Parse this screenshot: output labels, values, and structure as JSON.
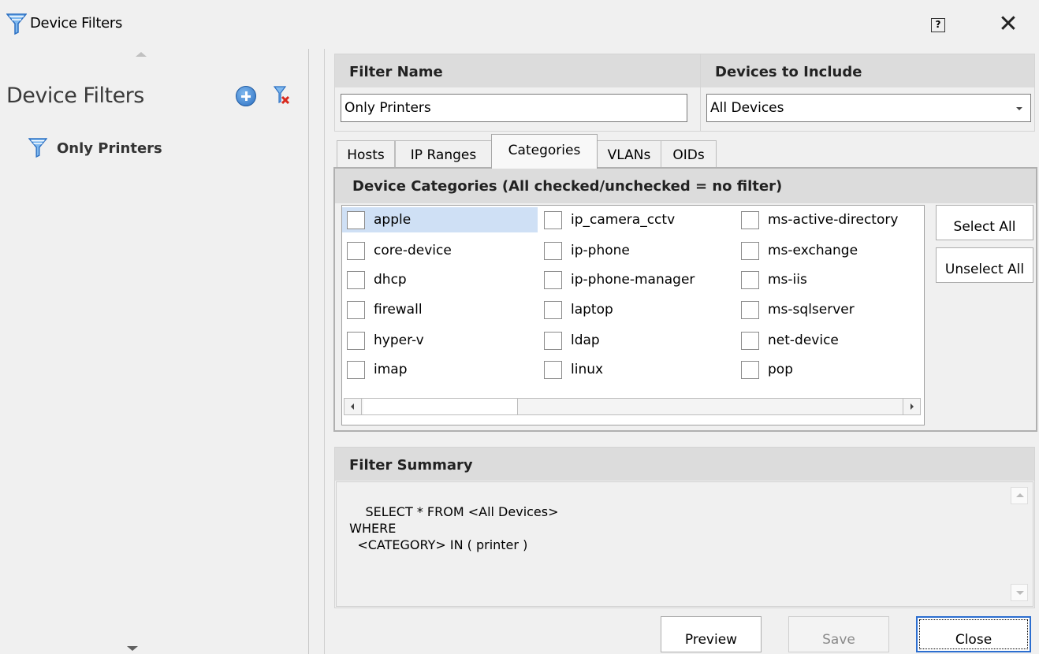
{
  "window": {
    "title": "Device Filters",
    "help_label": "?",
    "close_label": "✕"
  },
  "sidebar": {
    "title": "Device Filters",
    "items": [
      {
        "label": "Only Printers"
      }
    ]
  },
  "filter_name": {
    "header": "Filter Name",
    "value": "Only Printers"
  },
  "devices_to_include": {
    "header": "Devices to Include",
    "selected": "All Devices"
  },
  "tabs": [
    {
      "label": "Hosts"
    },
    {
      "label": "IP Ranges"
    },
    {
      "label": "Categories",
      "active": true
    },
    {
      "label": "VLANs"
    },
    {
      "label": "OIDs"
    }
  ],
  "categories": {
    "header": "Device Categories (All checked/unchecked = no filter)",
    "columns": [
      [
        "apple",
        "core-device",
        "dhcp",
        "firewall",
        "hyper-v",
        "imap"
      ],
      [
        "ip_camera_cctv",
        "ip-phone",
        "ip-phone-manager",
        "laptop",
        "ldap",
        "linux"
      ],
      [
        "ms-active-directory",
        "ms-exchange",
        "ms-iis",
        "ms-sqlserver",
        "net-device",
        "pop"
      ]
    ],
    "selected_item": "apple",
    "select_all_label": "Select All",
    "unselect_all_label": "Unselect All"
  },
  "summary": {
    "header": "Filter Summary",
    "text": "SELECT * FROM <All Devices>\n  WHERE\n    <CATEGORY> IN ( printer )"
  },
  "buttons": {
    "preview": "Preview",
    "save": "Save",
    "close": "Close"
  },
  "colors": {
    "selection": "#cfe0f5",
    "focus_border": "#2c6ed0",
    "header_bg": "#dcdcdc"
  },
  "icons": {
    "window": "funnel-icon",
    "add": "add-filter-icon",
    "delete": "delete-filter-icon",
    "tree_item": "funnel-icon"
  }
}
